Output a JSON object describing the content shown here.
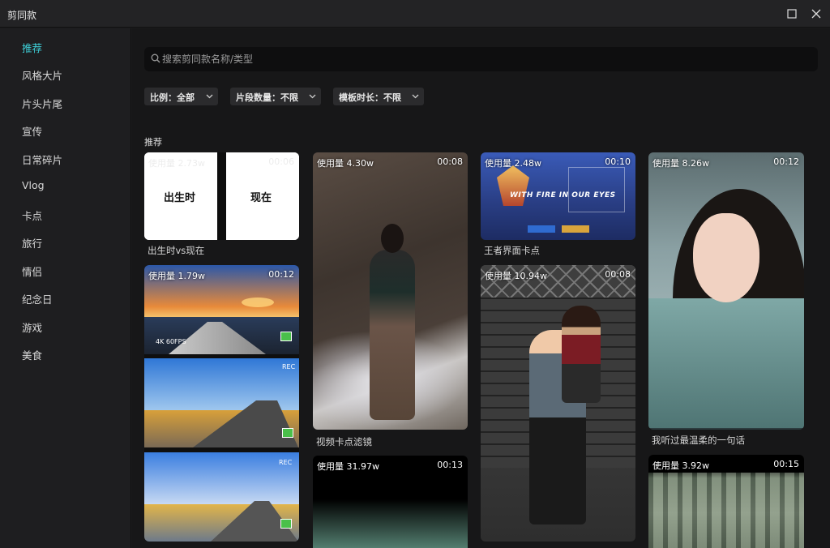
{
  "window": {
    "title": "剪同款"
  },
  "sidebar": {
    "items": [
      {
        "label": "推荐",
        "active": true
      },
      {
        "label": "风格大片"
      },
      {
        "label": "片头片尾"
      },
      {
        "label": "宣传"
      },
      {
        "label": "日常碎片"
      },
      {
        "label": "Vlog"
      },
      {
        "label": "卡点"
      },
      {
        "label": "旅行"
      },
      {
        "label": "情侣"
      },
      {
        "label": "纪念日"
      },
      {
        "label": "游戏"
      },
      {
        "label": "美食"
      }
    ]
  },
  "search": {
    "placeholder": "搜索剪同款名称/类型",
    "value": ""
  },
  "filters": [
    {
      "label": "比例：全部"
    },
    {
      "label": "片段数量：不限"
    },
    {
      "label": "模板时长：不限"
    }
  ],
  "section": {
    "title": "推荐"
  },
  "cards": [
    {
      "usage": "使用量 2.73w",
      "duration": "00:06",
      "caption": "出生时vs现在",
      "left_text": "出生时",
      "right_text": "现在"
    },
    {
      "usage": "使用量 1.79w",
      "duration": "00:12",
      "caption": "",
      "hud_4k": "4K 60FPS",
      "hud_rec": "REC"
    },
    {
      "usage": "使用量 4.30w",
      "duration": "00:08",
      "caption": "视频卡点滤镜"
    },
    {
      "usage": "使用量 31.97w",
      "duration": "00:13",
      "caption": ""
    },
    {
      "usage": "使用量 2.48w",
      "duration": "00:10",
      "caption": "王者界面卡点",
      "overlay": "WITH FIRE IN OUR EYES"
    },
    {
      "usage": "使用量 10.94w",
      "duration": "00:08",
      "caption": ""
    },
    {
      "usage": "使用量 8.26w",
      "duration": "00:12",
      "caption": "我听过最温柔的一句话"
    },
    {
      "usage": "使用量 3.92w",
      "duration": "00:15",
      "caption": ""
    }
  ],
  "colors": {
    "accent": "#3fd0d8",
    "background": "#171718",
    "sidebar": "#1e1e20"
  },
  "icons": {
    "search": "search-icon",
    "maximize": "maximize-icon",
    "close": "close-icon",
    "chevron": "chevron-down-icon"
  }
}
